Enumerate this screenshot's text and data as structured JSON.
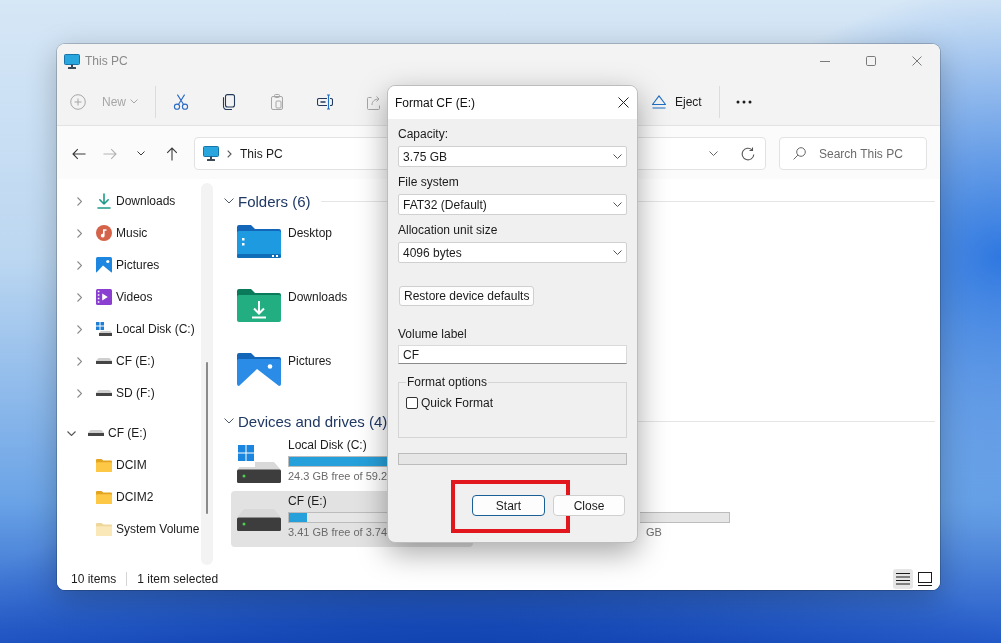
{
  "window": {
    "title": "This PC"
  },
  "toolbar": [
    {
      "kind": "new",
      "label": "New",
      "disabled": true
    },
    {
      "kind": "cut",
      "disabled": false
    },
    {
      "kind": "copy",
      "disabled": false
    },
    {
      "kind": "paste",
      "disabled": true
    },
    {
      "kind": "rename",
      "disabled": false
    },
    {
      "kind": "share",
      "disabled": true
    }
  ],
  "toolbar_right": [
    {
      "kind": "eject",
      "label": "Eject",
      "disabled": false
    },
    {
      "kind": "more",
      "disabled": false
    }
  ],
  "navigation": [
    {
      "kind": "back",
      "disabled": false
    },
    {
      "kind": "forward",
      "disabled": true
    },
    {
      "kind": "recent",
      "disabled": false
    },
    {
      "kind": "up",
      "disabled": false
    }
  ],
  "address": {
    "path": [
      "This PC"
    ]
  },
  "search": {
    "placeholder": "Search This PC"
  },
  "sidebar": {
    "this_pc_items": [
      {
        "kind": "downloads",
        "label": "Downloads",
        "expanded": false
      },
      {
        "kind": "music",
        "label": "Music",
        "expanded": false
      },
      {
        "kind": "pictures",
        "label": "Pictures",
        "expanded": false
      },
      {
        "kind": "videos",
        "label": "Videos",
        "expanded": false
      },
      {
        "kind": "disk",
        "label": "Local Disk (C:)",
        "expanded": false
      },
      {
        "kind": "drive",
        "label": "CF (E:)",
        "expanded": false
      },
      {
        "kind": "drive",
        "label": "SD (F:)",
        "expanded": false
      }
    ],
    "tree": [
      {
        "kind": "drive",
        "label": "CF (E:)",
        "expanded": true,
        "children": [
          {
            "kind": "folder",
            "label": "DCIM"
          },
          {
            "kind": "folder",
            "label": "DCIM2"
          },
          {
            "kind": "hidden",
            "label": "System Volume"
          }
        ]
      }
    ]
  },
  "folders": {
    "title": "Folders (6)",
    "expanded": true,
    "items": [
      {
        "kind": "desktop",
        "name": "Desktop"
      },
      {
        "kind": "downloads",
        "name": "Downloads"
      },
      {
        "kind": "pictures",
        "name": "Pictures"
      }
    ]
  },
  "drives": {
    "title": "Devices and drives (4)",
    "expanded": true,
    "items": [
      {
        "kind": "system",
        "name": "Local Disk (C:)",
        "level": 0.59,
        "free": "24.3 GB free of 59.2",
        "selected": false
      },
      {
        "kind": "removable",
        "name": "CF (E:)",
        "level": 0.09,
        "free": "3.41 GB free of 3.74",
        "selected": true
      }
    ],
    "partial_tile": {
      "free": "GB"
    }
  },
  "status_bar": {
    "items": "10 items",
    "selection": "1 item selected",
    "views": [
      {
        "kind": "details",
        "selected": true
      },
      {
        "kind": "tiles",
        "selected": false
      }
    ]
  },
  "dialog": {
    "title": "Format CF (E:)",
    "fields": [
      {
        "kind": "select",
        "label": "Capacity:",
        "value": "3.75 GB"
      },
      {
        "kind": "select",
        "label": "File system",
        "value": "FAT32 (Default)"
      },
      {
        "kind": "select",
        "label": "Allocation unit size",
        "value": "4096 bytes"
      },
      {
        "kind": "button",
        "label": "Restore device defaults"
      },
      {
        "kind": "input",
        "label": "Volume label",
        "value": "CF"
      }
    ],
    "format_options": {
      "title": "Format options",
      "options": [
        {
          "label": "Quick Format",
          "checked": false
        }
      ]
    },
    "progress": {
      "level": 0
    },
    "buttons": [
      {
        "label": "Start",
        "default": true,
        "highlighted": true
      },
      {
        "label": "Close",
        "default": false,
        "highlighted": false
      }
    ]
  }
}
